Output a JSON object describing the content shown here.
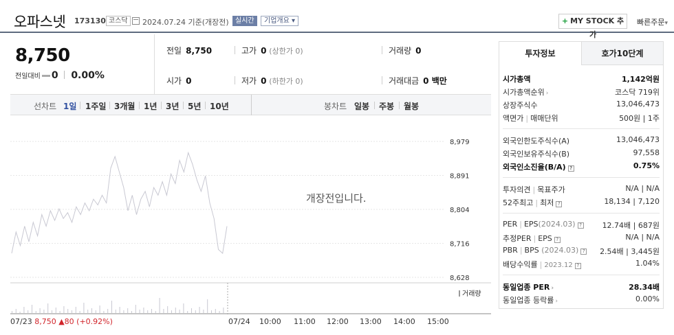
{
  "header": {
    "name": "오파스넷",
    "code": "173130",
    "market": "코스닥",
    "date": "2024.07.24 기준(개장전)",
    "realtime": "실시간",
    "company_info": "기업개요",
    "mystock": "MY STOCK 추가",
    "quick_order": "빠른주문"
  },
  "price": {
    "current": "8,750",
    "diff_label": "전일대비",
    "diff_value": "0",
    "diff_pct": "0.00%"
  },
  "summary": {
    "prev_label": "전일",
    "prev": "8,750",
    "high_label": "고가",
    "high": "0",
    "high_sub": "(상한가 0)",
    "volume_label": "거래량",
    "volume": "0",
    "open_label": "시가",
    "open": "0",
    "low_label": "저가",
    "low": "0",
    "low_sub": "(하한가 0)",
    "amount_label": "거래대금",
    "amount": "0 백만"
  },
  "tabs": {
    "line_label": "선차트",
    "periods": [
      "1일",
      "1주일",
      "3개월",
      "1년",
      "3년",
      "5년",
      "10년"
    ],
    "candle_label": "봉차트",
    "candles": [
      "일봉",
      "주봉",
      "월봉"
    ]
  },
  "chart": {
    "closed_message": "개장전입니다.",
    "volume_label": "거래량",
    "y_ticks": [
      "8,979",
      "8,891",
      "8,804",
      "8,716",
      "8,628"
    ],
    "x_prev_date": "07/23",
    "x_prev_price": "8,750",
    "x_prev_change": "▲80 (+0.92%)",
    "x_ticks": [
      "07/24",
      "10:00",
      "11:00",
      "12:00",
      "13:00",
      "14:00",
      "15:00"
    ]
  },
  "chart_data": {
    "type": "line",
    "y_range": [
      8628,
      8979
    ],
    "series": [
      {
        "values": [
          8690,
          8745,
          8710,
          8760,
          8720,
          8770,
          8735,
          8790,
          8760,
          8800,
          8775,
          8805,
          8780,
          8795,
          8770,
          8810,
          8790,
          8820,
          8800,
          8830,
          8815,
          8840,
          8820,
          8910,
          8940,
          8900,
          8860,
          8800,
          8840,
          8790,
          8830,
          8850,
          8810,
          8860,
          8840,
          8875,
          8840,
          8895,
          8870,
          8930,
          8900,
          8950,
          8920,
          8880,
          8850,
          8890,
          8820,
          8780,
          8700,
          8690,
          8760
        ]
      }
    ]
  },
  "right": {
    "tab_active": "투자정보",
    "tab_other": "호가10단계",
    "market_cap_label": "시가총액",
    "market_cap": "1,142억원",
    "cap_rank_label": "시가총액순위",
    "cap_rank": "코스닥 719위",
    "shares_label": "상장주식수",
    "shares": "13,046,473",
    "par_label": "액면가",
    "unit_label": "매매단위",
    "par_unit": "500원 | 1주",
    "foreign_limit_label": "외국인한도주식수(A)",
    "foreign_limit": "13,046,473",
    "foreign_hold_label": "외국인보유주식수(B)",
    "foreign_hold": "97,558",
    "foreign_rate_label": "외국인소진율(B/A)",
    "foreign_rate": "0.75%",
    "opinion_label": "투자의견",
    "target_label": "목표주가",
    "opinion_target": "N/A | N/A",
    "w52_label": "52주최고",
    "w52_low_label": "최저",
    "w52": "18,134 | 7,120",
    "per_label": "PER",
    "eps_label": "EPS",
    "eps_year": "(2024.03)",
    "per_eps": "12.74배 | 687원",
    "est_per_label": "추정PER",
    "est_eps_label": "EPS",
    "est_per_eps": "N/A | N/A",
    "pbr_label": "PBR",
    "bps_label": "BPS",
    "bps_year": "(2024.03)",
    "pbr_bps": "2.54배 | 3,445원",
    "dividend_label": "배당수익률",
    "dividend_year": "2023.12",
    "dividend": "1.04%",
    "peer_per_label": "동일업종 PER",
    "peer_per": "28.34배",
    "peer_rate_label": "동일업종 등락률",
    "peer_rate": "0.00%"
  }
}
